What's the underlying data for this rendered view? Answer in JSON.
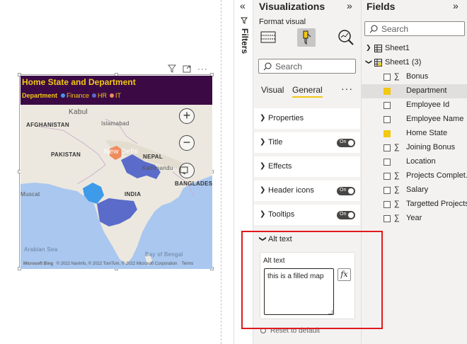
{
  "visual": {
    "title": "Home State and Department",
    "legend_title": "Department",
    "legend": [
      {
        "label": "Finance",
        "color": "#3d9be9"
      },
      {
        "label": "HR",
        "color": "#5b6bc9"
      },
      {
        "label": "IT",
        "color": "#f08a5d"
      }
    ],
    "map_labels": {
      "kabul": "Kabul",
      "afghanistan": "AFGHANISTAN",
      "islamabad": "Islamabad",
      "pakistan": "PAKISTAN",
      "new_delhi": "New Delhi",
      "nepal": "NEPAL",
      "kathmandu": "Kathmandu",
      "bangladesh": "BANGLADESH",
      "india": "INDIA",
      "muscat": "Muscat",
      "arabian_sea": "Arabian Sea",
      "bay_of_bengal": "Bay of Bengal"
    },
    "zoom_in": "+",
    "zoom_out": "−",
    "copyright": "© 2022 NavInfo, © 2022 TomTom, © 2022 Microsoft Corporation",
    "terms": "Terms",
    "bing": "Microsoft Bing"
  },
  "filters_pane": {
    "label": "Filters",
    "collapse": "«"
  },
  "viz_pane": {
    "title": "Visualizations",
    "expand": "»",
    "format_visual": "Format visual",
    "search_placeholder": "Search",
    "tabs": [
      "Visual",
      "General"
    ],
    "more": "···",
    "sections": [
      {
        "label": "Properties",
        "toggle": ""
      },
      {
        "label": "Title",
        "toggle": "On"
      },
      {
        "label": "Effects",
        "toggle": ""
      },
      {
        "label": "Header icons",
        "toggle": "On"
      },
      {
        "label": "Tooltips",
        "toggle": "On"
      }
    ],
    "alt_text_section": "Alt text",
    "alt_text_caption": "Alt text",
    "alt_text_value": "this is a filled map",
    "fx_label": "fx",
    "reset": "Reset to default"
  },
  "fields_pane": {
    "title": "Fields",
    "expand": "»",
    "search_placeholder": "Search",
    "tables": [
      {
        "name": "Sheet1",
        "expanded": false
      },
      {
        "name": "Sheet1 (3)",
        "expanded": true
      }
    ],
    "fields": [
      {
        "name": "Bonus",
        "sigma": "∑",
        "checked": false
      },
      {
        "name": "Department",
        "sigma": "",
        "checked": true
      },
      {
        "name": "Employee Id",
        "sigma": "",
        "checked": false
      },
      {
        "name": "Employee Name",
        "sigma": "",
        "checked": false
      },
      {
        "name": "Home State",
        "sigma": "",
        "checked": true
      },
      {
        "name": "Joining Bonus",
        "sigma": "∑",
        "checked": false
      },
      {
        "name": "Location",
        "sigma": "",
        "checked": false
      },
      {
        "name": "Projects Complet...",
        "sigma": "∑",
        "checked": false
      },
      {
        "name": "Salary",
        "sigma": "∑",
        "checked": false
      },
      {
        "name": "Targetted Projects",
        "sigma": "∑",
        "checked": false
      },
      {
        "name": "Year",
        "sigma": "∑",
        "checked": false
      }
    ]
  }
}
